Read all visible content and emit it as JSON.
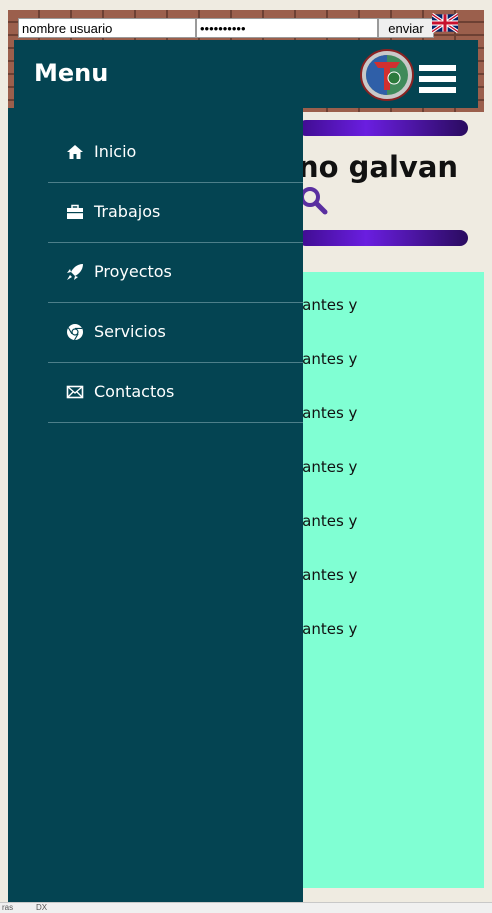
{
  "login": {
    "username_value": "nombre usuario",
    "password_value": "••••••••••",
    "submit_label": "enviar",
    "language_flag": "uk-flag-icon"
  },
  "header": {
    "menu_title": "Menu",
    "logo": "school-emblem-logo",
    "menu_toggle": "hamburger-icon"
  },
  "page": {
    "title_fragment": "no galvan",
    "rows": [
      "iantes y",
      "iantes y",
      "iantes y",
      "iantes y",
      "iantes y",
      "iantes y",
      "iantes y"
    ]
  },
  "drawer": {
    "items": [
      {
        "label": "Inicio",
        "icon": "home-icon"
      },
      {
        "label": "Trabajos",
        "icon": "briefcase-icon"
      },
      {
        "label": "Proyectos",
        "icon": "rocket-icon"
      },
      {
        "label": "Servicios",
        "icon": "chrome-icon"
      },
      {
        "label": "Contactos",
        "icon": "envelope-icon"
      }
    ]
  },
  "statusbar": {
    "left_text": "ras",
    "right_text": "DX"
  },
  "colors": {
    "drawer_bg": "#044452",
    "content_bg": "#80ffd3",
    "stripe": "#6a1ee0",
    "page_bg": "#efebe1"
  }
}
